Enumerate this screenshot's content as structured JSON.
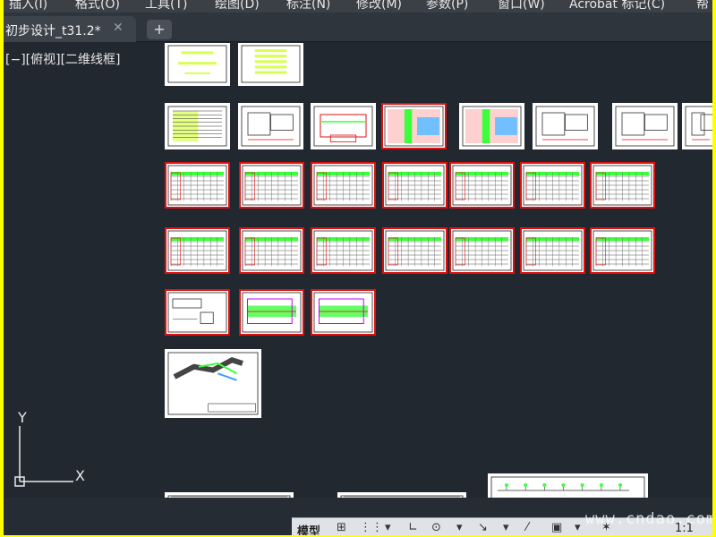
{
  "menubar": {
    "items": [
      "插入(I)",
      "格式(O)",
      "工具(T)",
      "绘图(D)",
      "标注(N)",
      "修改(M)",
      "参数(P)",
      "窗口(W)",
      "Acrobat 标记(C)",
      "帮"
    ]
  },
  "tabs": {
    "active_label": "初步设计_t31.2*",
    "close_glyph": "✕",
    "new_glyph": "+"
  },
  "viewport": {
    "label_parts": [
      "[−]",
      "[俯视]",
      "[二维线框]"
    ]
  },
  "ucs": {
    "y_label": "Y",
    "x_label": "X"
  },
  "statusbar": {
    "model_label": "模型",
    "scale_label": "1:1"
  },
  "watermark": "www.cndao.com",
  "colors": {
    "canvas": "#212830",
    "frame": "#ffff00",
    "sheet_border_white": "#ffffff",
    "sheet_border_red": "#e01010",
    "green": "#3cff3c",
    "yellow_green": "#d8ff50"
  }
}
